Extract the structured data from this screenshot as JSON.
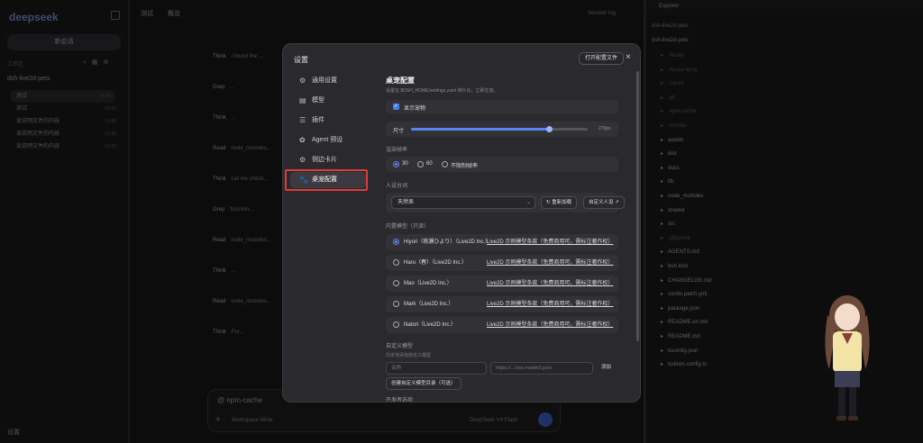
{
  "app": {
    "brand": "deepseek",
    "brand_badge": "",
    "new_chat": "新会话",
    "workspace_label": "工作区",
    "project": "dsh-live2d-pets",
    "sessions": [
      {
        "title": "测试",
        "time": "3小时"
      },
      {
        "title": "测试",
        "time": "3小时"
      },
      {
        "title": "谈说明文件的内容",
        "time": "3小时"
      },
      {
        "title": "谈说明文件的内容",
        "time": "3小时"
      },
      {
        "title": "谈说明文件的内容",
        "time": "3小时"
      }
    ],
    "settings_link": "设置",
    "main_tabs": [
      "测试",
      "概览"
    ],
    "top_right": "Session log",
    "timeline": [
      {
        "k": "Think",
        "v": "I found the ..."
      },
      {
        "k": "Grep",
        "v": "..."
      },
      {
        "k": "Think",
        "v": "..."
      },
      {
        "k": "Read",
        "v": "node_modules..."
      },
      {
        "k": "Think",
        "v": "Let me check..."
      },
      {
        "k": "Grep",
        "v": "function..."
      },
      {
        "k": "Read",
        "v": "node_modules..."
      },
      {
        "k": "Think",
        "v": "..."
      },
      {
        "k": "Read",
        "v": "node_modules..."
      },
      {
        "k": "Think",
        "v": "For..."
      }
    ],
    "composer_placeholder": "@ npm-cache",
    "composer_workspace": "Workspace Write",
    "composer_model": "DeepSeek V4 Flash",
    "files_tab": "Explorer",
    "files_path": "dsh-live2d-pets",
    "files_root": "dsh-live2d-pets",
    "files": [
      {
        "name": ".husky",
        "dim": true
      },
      {
        "name": ".husky-temp",
        "dim": true
      },
      {
        "name": ".cursor",
        "dim": true
      },
      {
        "name": ".git",
        "dim": true
      },
      {
        "name": ".npm-cache",
        "dim": true
      },
      {
        "name": ".vscode",
        "dim": true
      },
      {
        "name": "assets",
        "dim": false
      },
      {
        "name": "dist",
        "dim": false
      },
      {
        "name": "docs",
        "dim": false
      },
      {
        "name": "lib",
        "dim": false
      },
      {
        "name": "node_modules",
        "dim": false
      },
      {
        "name": "shared",
        "dim": false
      },
      {
        "name": "src",
        "dim": false
      },
      {
        "name": ".gitignore",
        "dim": true
      },
      {
        "name": "AGENTS.md",
        "dim": false
      },
      {
        "name": "bun.lock",
        "dim": false
      },
      {
        "name": "CHANGELOG.md",
        "dim": false
      },
      {
        "name": "cordis.patch.yml",
        "dim": false
      },
      {
        "name": "package.json",
        "dim": false
      },
      {
        "name": "README.en.md",
        "dim": false
      },
      {
        "name": "README.md",
        "dim": false
      },
      {
        "name": "tsconfig.json",
        "dim": false
      },
      {
        "name": "tsdown.config.ts",
        "dim": false
      }
    ]
  },
  "modal": {
    "title": "设置",
    "open_config": "打开配置文件",
    "close": "×",
    "nav": [
      {
        "label": "通用设置",
        "icon": "⚙"
      },
      {
        "label": "模型",
        "icon": "▤"
      },
      {
        "label": "插件",
        "icon": "☰"
      },
      {
        "label": "Agent 预设",
        "icon": "✿"
      },
      {
        "label": "侧边卡片",
        "icon": "⚙"
      },
      {
        "label": "桌宠配置",
        "icon": "🐾"
      }
    ],
    "active_nav_index": 5,
    "content": {
      "heading": "桌宠配置",
      "subheading": "设置在 $DSH_HOME/settings.yaml 持久化，立即生效。",
      "show_pet_label": "显示宠物",
      "show_pet_checked": true,
      "size_label": "尺寸",
      "size_value": "279px",
      "size_fraction": 0.78,
      "fps_section": "渲染帧率",
      "fps_options": [
        "30",
        "60",
        "不限制帧率"
      ],
      "fps_selected": 0,
      "lines_section": "人设台词",
      "lines_select": "天然呆",
      "reload_button": "↻ 重新加载",
      "custom_button": "自定义人设 ↗",
      "builtin_section": "内置模型（只读）",
      "models": [
        {
          "name": "Hiyori（桃瀬ひより）（Live2D Inc.）",
          "license": "Live2D 示例模型条款（免费商用可，需标注著作权）",
          "selected": true
        },
        {
          "name": "Haru（春）（Live2D Inc.）",
          "license": "Live2D 示例模型条款（免费商用可，需标注著作权）",
          "selected": false
        },
        {
          "name": "Mao（Live2D Inc.）",
          "license": "Live2D 示例模型条款（免费商用可，需标注著作权）",
          "selected": false
        },
        {
          "name": "Mark（Live2D Inc.）",
          "license": "Live2D 示例模型条款（免费商用可，需标注著作权）",
          "selected": false
        },
        {
          "name": "Natori（Live2D Inc.）",
          "license": "Live2D 示例模型条款（免费商用可，需标注著作权）",
          "selected": false
        }
      ],
      "custom_section": "自定义模型",
      "custom_hint": "向本地添加自定义模型",
      "name_placeholder": "名称",
      "path_placeholder": "https://.../xxx.model3.json",
      "add_button": "添加",
      "create_dir_button": "创建自定义模型目录（可选）",
      "dev_section": "开发者选项"
    }
  },
  "colors": {
    "accent": "#5b84f2",
    "highlight": "#e03a3a",
    "modal_bg": "#2a2a2e"
  }
}
